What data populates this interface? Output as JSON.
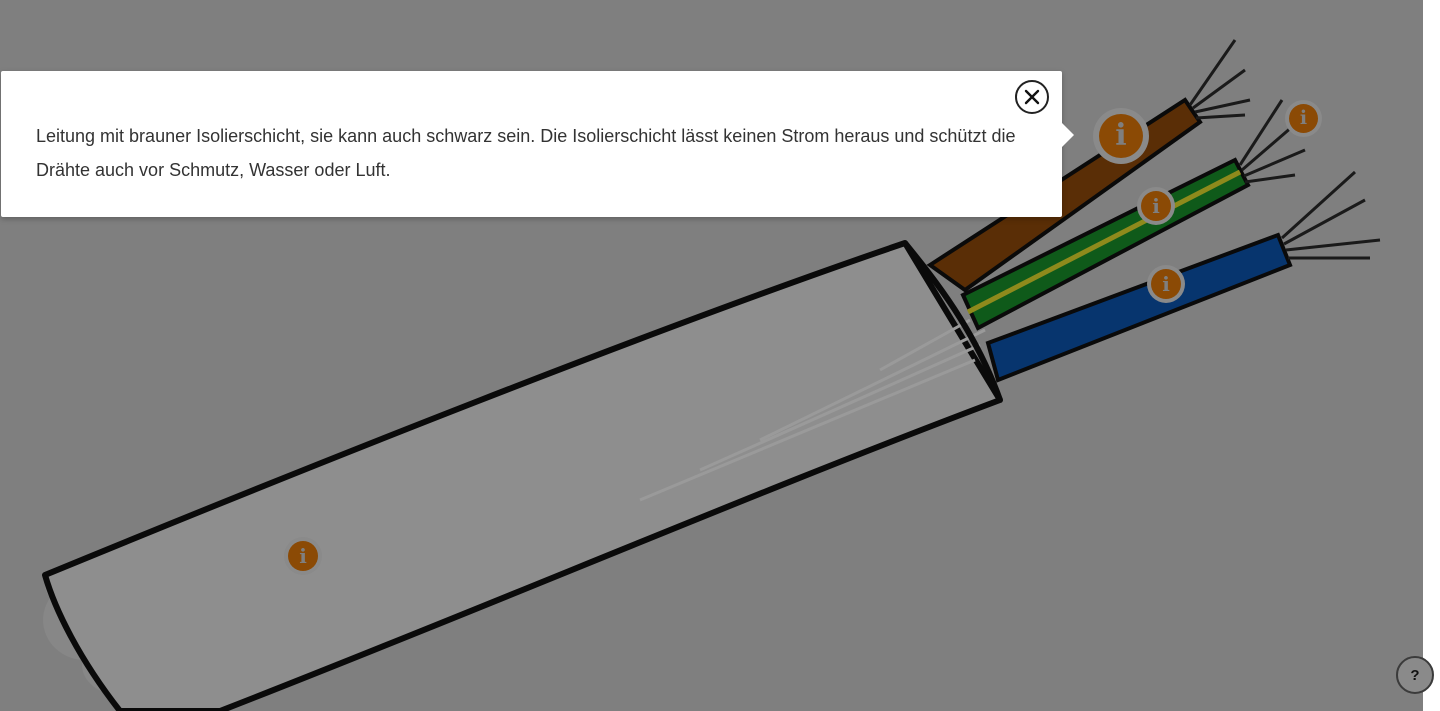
{
  "popup": {
    "text": "Leitung mit brauner Isolierschicht, sie kann auch schwarz sein. Die Isolierschicht lässt keinen Strom heraus und schützt die Drähte auch vor Schmutz, Wasser oder Luft.",
    "close_label": "×"
  },
  "hotspots": {
    "glyph": "i",
    "brown": "i",
    "brown_tips": "i",
    "green_yellow": "i",
    "blue": "i",
    "sheath": "i"
  },
  "help": {
    "label": "?"
  },
  "colors": {
    "overlay": "#7f7f7f",
    "hotspot": "#8b4a05",
    "popup_bg": "#ffffff",
    "wire_brown": "#5a2e06",
    "wire_green": "#0f5a1a",
    "wire_yellow": "#8e8a1c",
    "wire_blue": "#07356e",
    "sheath": "#8e8e8e"
  }
}
